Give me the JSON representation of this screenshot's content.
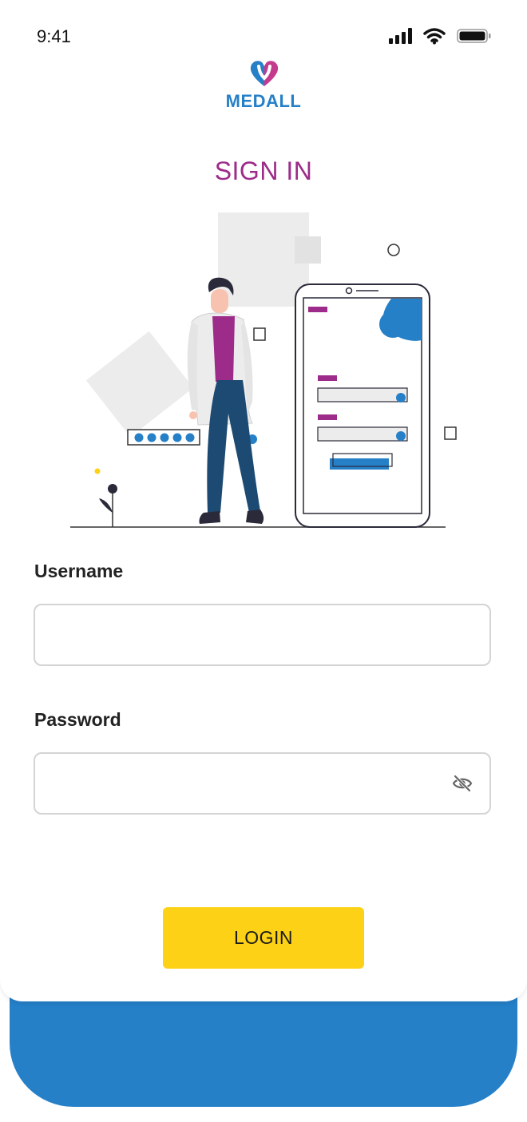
{
  "status_bar": {
    "time": "9:41",
    "signal_icon": "cellular-signal-icon",
    "wifi_icon": "wifi-icon",
    "battery_icon": "battery-icon"
  },
  "brand": {
    "name": "MEDALL",
    "logo_icon": "heart-logo-icon"
  },
  "page": {
    "title": "SIGN IN"
  },
  "form": {
    "username": {
      "label": "Username",
      "value": "",
      "placeholder": ""
    },
    "password": {
      "label": "Password",
      "value": "",
      "placeholder": "",
      "toggle_icon": "eye-off-icon"
    },
    "submit_label": "LOGIN"
  },
  "colors": {
    "primary_blue": "#2580c8",
    "brand_purple": "#9c2b89",
    "accent_yellow": "#fdd116",
    "field_border": "#d4d4d4"
  }
}
